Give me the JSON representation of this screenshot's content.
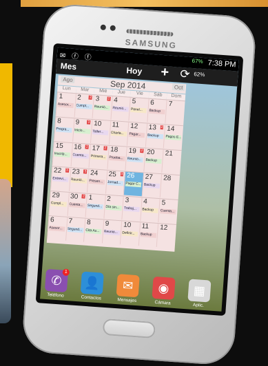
{
  "phone": {
    "brand": "SAMSUNG",
    "status_bar": {
      "notification_icons": "✉ ⓕ ⓕ",
      "battery_pct": "67%",
      "time": "7:38 PM"
    }
  },
  "app_header": {
    "month_label": "Mes",
    "today_label": "Hoy",
    "add_label": "+",
    "sync_pct": "62%"
  },
  "calendar": {
    "prev_label": "Ago",
    "title": "Sep 2014",
    "next_label": "Oct",
    "weekdays": [
      "Lun",
      "Mar",
      "Mié",
      "Jue",
      "Vie",
      "Sáb",
      "Dom"
    ],
    "weeks": [
      {
        "days": [
          {
            "n": "1",
            "ev": [
              "Asesor..."
            ]
          },
          {
            "n": "2",
            "ev": [
              "Cumpl..."
            ],
            "badge": "2"
          },
          {
            "n": "3",
            "ev": [
              "Reunió..."
            ],
            "badge": "2"
          },
          {
            "n": "4",
            "ev": [
              "Reunió..."
            ]
          },
          {
            "n": "5",
            "ev": [
              "Panel..."
            ]
          },
          {
            "n": "6",
            "ev": [
              "Backup"
            ]
          },
          {
            "n": "7",
            "ev": []
          }
        ]
      },
      {
        "days": [
          {
            "n": "8",
            "ev": [
              "Progra..."
            ]
          },
          {
            "n": "9",
            "ev": [
              "Inicio..."
            ],
            "badge": "3"
          },
          {
            "n": "10",
            "ev": [
              "Taller..."
            ]
          },
          {
            "n": "11",
            "ev": [
              "Charla..."
            ]
          },
          {
            "n": "12",
            "ev": [
              "Pagar..."
            ]
          },
          {
            "n": "13",
            "ev": [
              "Backup"
            ],
            "badge": "2"
          },
          {
            "n": "14",
            "ev": [
              "Pagos E..."
            ]
          }
        ]
      },
      {
        "days": [
          {
            "n": "15",
            "ev": [
              "Inscrip..."
            ]
          },
          {
            "n": "16",
            "ev": [
              "Cuenta..."
            ],
            "badge": "2"
          },
          {
            "n": "17",
            "ev": [
              "Primera..."
            ],
            "badge": "2"
          },
          {
            "n": "18",
            "ev": [
              "Prueba..."
            ]
          },
          {
            "n": "19",
            "ev": [
              "Reunió..."
            ],
            "badge": "2"
          },
          {
            "n": "20",
            "ev": [
              "Backup"
            ]
          },
          {
            "n": "21",
            "ev": []
          }
        ]
      },
      {
        "days": [
          {
            "n": "22",
            "ev": [
              "Entrevi..."
            ],
            "badge": "3"
          },
          {
            "n": "23",
            "ev": [
              "Reunió..."
            ],
            "badge": "3"
          },
          {
            "n": "24",
            "ev": [
              "Presen..."
            ]
          },
          {
            "n": "25",
            "ev": [
              "Jornad..."
            ],
            "badge": "3"
          },
          {
            "n": "26",
            "ev": [
              "Pagar C..."
            ],
            "today": true
          },
          {
            "n": "27",
            "ev": [
              "Backup"
            ]
          },
          {
            "n": "28",
            "ev": []
          }
        ]
      },
      {
        "days": [
          {
            "n": "29",
            "ev": [
              "Cumpl..."
            ]
          },
          {
            "n": "30",
            "ev": [
              "Cuenta..."
            ],
            "badge": "2"
          },
          {
            "n": "1",
            "ev": [
              "Segund..."
            ]
          },
          {
            "n": "2",
            "ev": [
              "Día sin..."
            ]
          },
          {
            "n": "3",
            "ev": [
              "Trabaj..."
            ]
          },
          {
            "n": "4",
            "ev": [
              "Backup"
            ]
          },
          {
            "n": "5",
            "ev": [
              "Cuenta..."
            ]
          }
        ]
      },
      {
        "days": [
          {
            "n": "6",
            "ev": [
              "Asesor..."
            ]
          },
          {
            "n": "7",
            "ev": [
              "Segund..."
            ]
          },
          {
            "n": "8",
            "ev": [
              "Cita Au..."
            ]
          },
          {
            "n": "9",
            "ev": [
              "Reunió..."
            ]
          },
          {
            "n": "10",
            "ev": [
              "Definir..."
            ]
          },
          {
            "n": "11",
            "ev": [
              "Backup"
            ]
          },
          {
            "n": "12",
            "ev": []
          }
        ]
      }
    ]
  },
  "dock": {
    "apps": [
      {
        "label": "Teléfono",
        "icon": "phone-icon",
        "color": "#8a4fb0",
        "badge": "1"
      },
      {
        "label": "Contactos",
        "icon": "contacts-icon",
        "color": "#2d8fd8"
      },
      {
        "label": "Mensajes",
        "icon": "messages-icon",
        "color": "#f08a3a"
      },
      {
        "label": "Cámara",
        "icon": "camera-icon",
        "color": "#e04848"
      },
      {
        "label": "Aplic.",
        "icon": "apps-grid-icon",
        "color": "#d8d8d8"
      }
    ]
  }
}
